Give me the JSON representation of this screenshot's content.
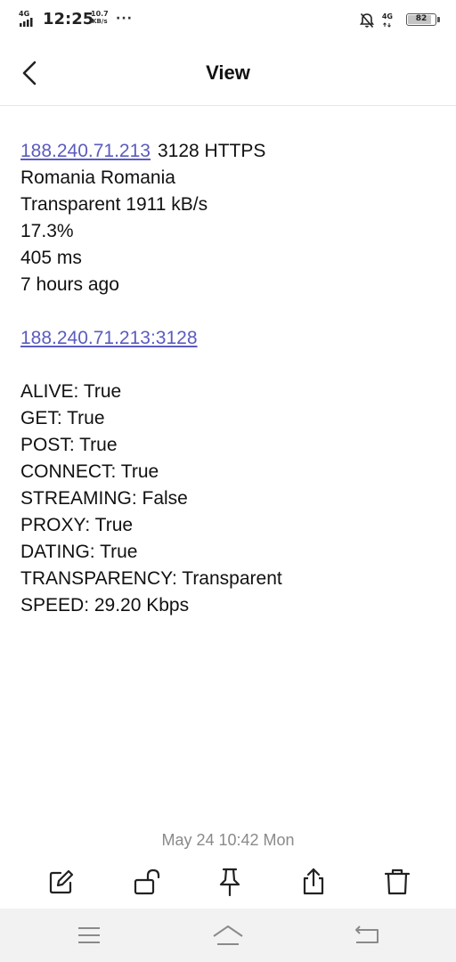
{
  "status_bar": {
    "network": "4G",
    "time": "12:25",
    "speed_value": "10.7",
    "speed_unit": "KB/s",
    "more": "···",
    "network_right": "4G",
    "battery": "82"
  },
  "header": {
    "title": "View"
  },
  "note": {
    "ip_link": "188.240.71.213",
    "port_type": "3128 HTTPS",
    "location": "Romania Romania",
    "anonymity_speed": "Transparent 1911 kB/s",
    "uptime": "17.3%",
    "latency": "405 ms",
    "checked": "7 hours ago",
    "address_link": "188.240.71.213:3128",
    "checks": [
      "ALIVE: True",
      "GET:  True",
      "POST:  True",
      "CONNECT: True",
      "STREAMING:  False",
      "PROXY:  True",
      "DATING:  True",
      "TRANSPARENCY:  Transparent",
      "SPEED:  29.20 Kbps"
    ]
  },
  "footer": {
    "date": "May 24 10:42 Mon"
  },
  "toolbar": {
    "icons": [
      "edit-icon",
      "unlock-icon",
      "pin-icon",
      "share-icon",
      "delete-icon"
    ]
  },
  "navbar": {
    "icons": [
      "menu-icon",
      "home-icon",
      "back-nav-icon"
    ]
  },
  "colors": {
    "link": "#5b5bbf",
    "date": "#8a8a8a",
    "navbar_bg": "#f2f2f2"
  }
}
